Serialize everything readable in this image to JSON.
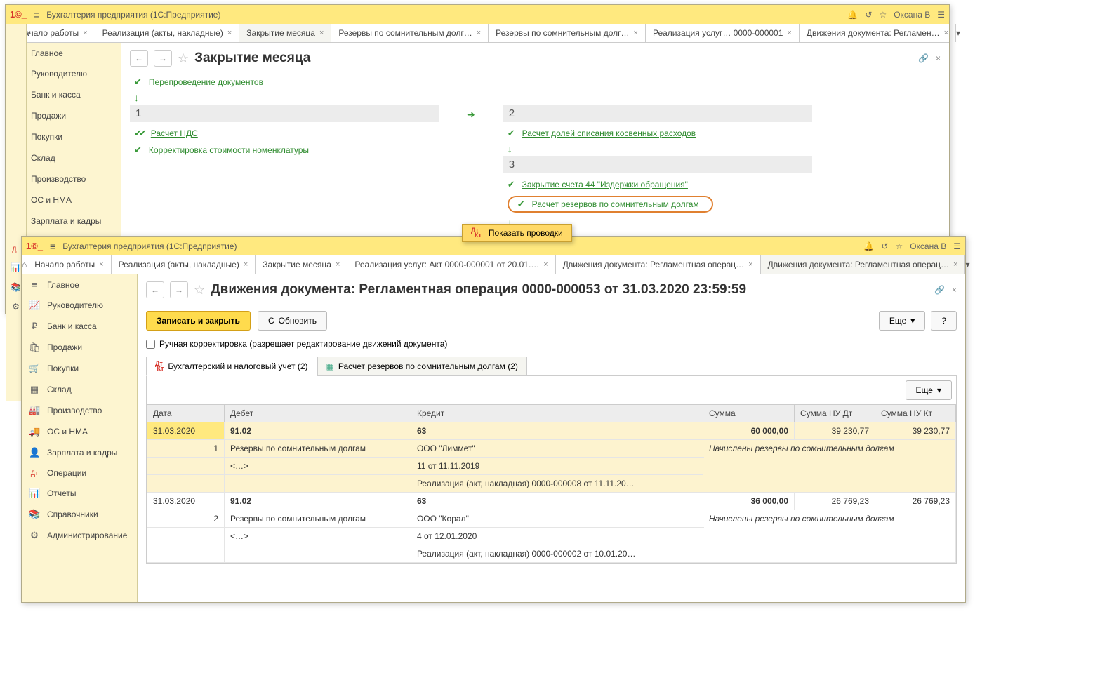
{
  "app": {
    "title": "Бухгалтерия предприятия   (1С:Предприятие)",
    "user": "Оксана В"
  },
  "win1": {
    "tabs": [
      {
        "label": "Начало работы"
      },
      {
        "label": "Реализация (акты, накладные)"
      },
      {
        "label": "Закрытие месяца",
        "active": true
      },
      {
        "label": "Резервы по сомнительным долг…"
      },
      {
        "label": "Резервы по сомнительным долг…"
      },
      {
        "label": "Реализация услуг…   0000-000001"
      },
      {
        "label": "Движения документа: Регламен…"
      }
    ],
    "page_title": "Закрытие месяца",
    "reposting": "Перепроведение документов",
    "col1": {
      "num": "1",
      "items": [
        "Расчет НДС",
        "Корректировка стоимости номенклатуры"
      ]
    },
    "col2": {
      "num": "2",
      "item": "Расчет долей списания косвенных расходов"
    },
    "col3": {
      "num": "3",
      "items": [
        "Закрытие счета 44 \"Издержки обращения\"",
        "Расчет резервов по сомнительным долгам"
      ]
    },
    "popup": "Показать проводки"
  },
  "win2": {
    "tabs": [
      {
        "label": "Начало работы"
      },
      {
        "label": "Реализация (акты, накладные)"
      },
      {
        "label": "Закрытие месяца"
      },
      {
        "label": "Реализация услуг: Акт 0000-000001 от 20.01.…"
      },
      {
        "label": "Движения документа: Регламентная операц…"
      },
      {
        "label": "Движения документа: Регламентная операц…",
        "active": true
      }
    ],
    "page_title": "Движения документа: Регламентная операция 0000-000053 от 31.03.2020 23:59:59",
    "btn_save": "Записать и закрыть",
    "btn_refresh": "Обновить",
    "btn_more": "Еще",
    "checkbox": "Ручная корректировка (разрешает редактирование движений документа)",
    "subtab1": "Бухгалтерский и налоговый учет (2)",
    "subtab2": "Расчет резервов по сомнительным долгам (2)",
    "table": {
      "headers": {
        "date": "Дата",
        "debit": "Дебет",
        "credit": "Кредит",
        "sum": "Сумма",
        "sum_nu_dt": "Сумма НУ Дт",
        "sum_nu_kt": "Сумма НУ Кт"
      },
      "rows": [
        {
          "date": "31.03.2020",
          "n": "1",
          "d_acc": "91.02",
          "d_sub": "Резервы по сомнительным долгам",
          "d_ext": "<…>",
          "c_acc": "63",
          "c_sub1": "ООО \"Лиммет\"",
          "c_sub2": "11 от 11.11.2019",
          "c_sub3": "Реализация (акт, накладная) 0000-000008 от 11.11.20…",
          "sum": "60 000,00",
          "nu_dt": "39 230,77",
          "nu_kt": "39 230,77",
          "note": "Начислены резервы по сомнительным долгам",
          "hl": true
        },
        {
          "date": "31.03.2020",
          "n": "2",
          "d_acc": "91.02",
          "d_sub": "Резервы по сомнительным долгам",
          "d_ext": "<…>",
          "c_acc": "63",
          "c_sub1": "ООО \"Корал\"",
          "c_sub2": "4 от 12.01.2020",
          "c_sub3": "Реализация (акт, накладная) 0000-000002 от 10.01.20…",
          "sum": "36 000,00",
          "nu_dt": "26 769,23",
          "nu_kt": "26 769,23",
          "note": "Начислены резервы по сомнительным долгам",
          "hl": false
        }
      ]
    }
  },
  "sidebar": [
    {
      "icon": "≡",
      "label": "Главное"
    },
    {
      "icon": "📈",
      "label": "Руководителю"
    },
    {
      "icon": "₽",
      "label": "Банк и касса"
    },
    {
      "icon": "🛍",
      "label": "Продажи"
    },
    {
      "icon": "🛒",
      "label": "Покупки"
    },
    {
      "icon": "▦",
      "label": "Склад"
    },
    {
      "icon": "🏭",
      "label": "Производство"
    },
    {
      "icon": "🚚",
      "label": "ОС и НМА"
    },
    {
      "icon": "👤",
      "label": "Зарплата и кадры"
    }
  ],
  "sidebar2_extra": [
    {
      "icon": "Дт",
      "label": "Операции"
    },
    {
      "icon": "📊",
      "label": "Отчеты"
    },
    {
      "icon": "📚",
      "label": "Справочники"
    },
    {
      "icon": "⚙",
      "label": "Администрирование"
    }
  ],
  "icon_strip": [
    "Дт",
    "📊",
    "📚",
    "⚙"
  ]
}
